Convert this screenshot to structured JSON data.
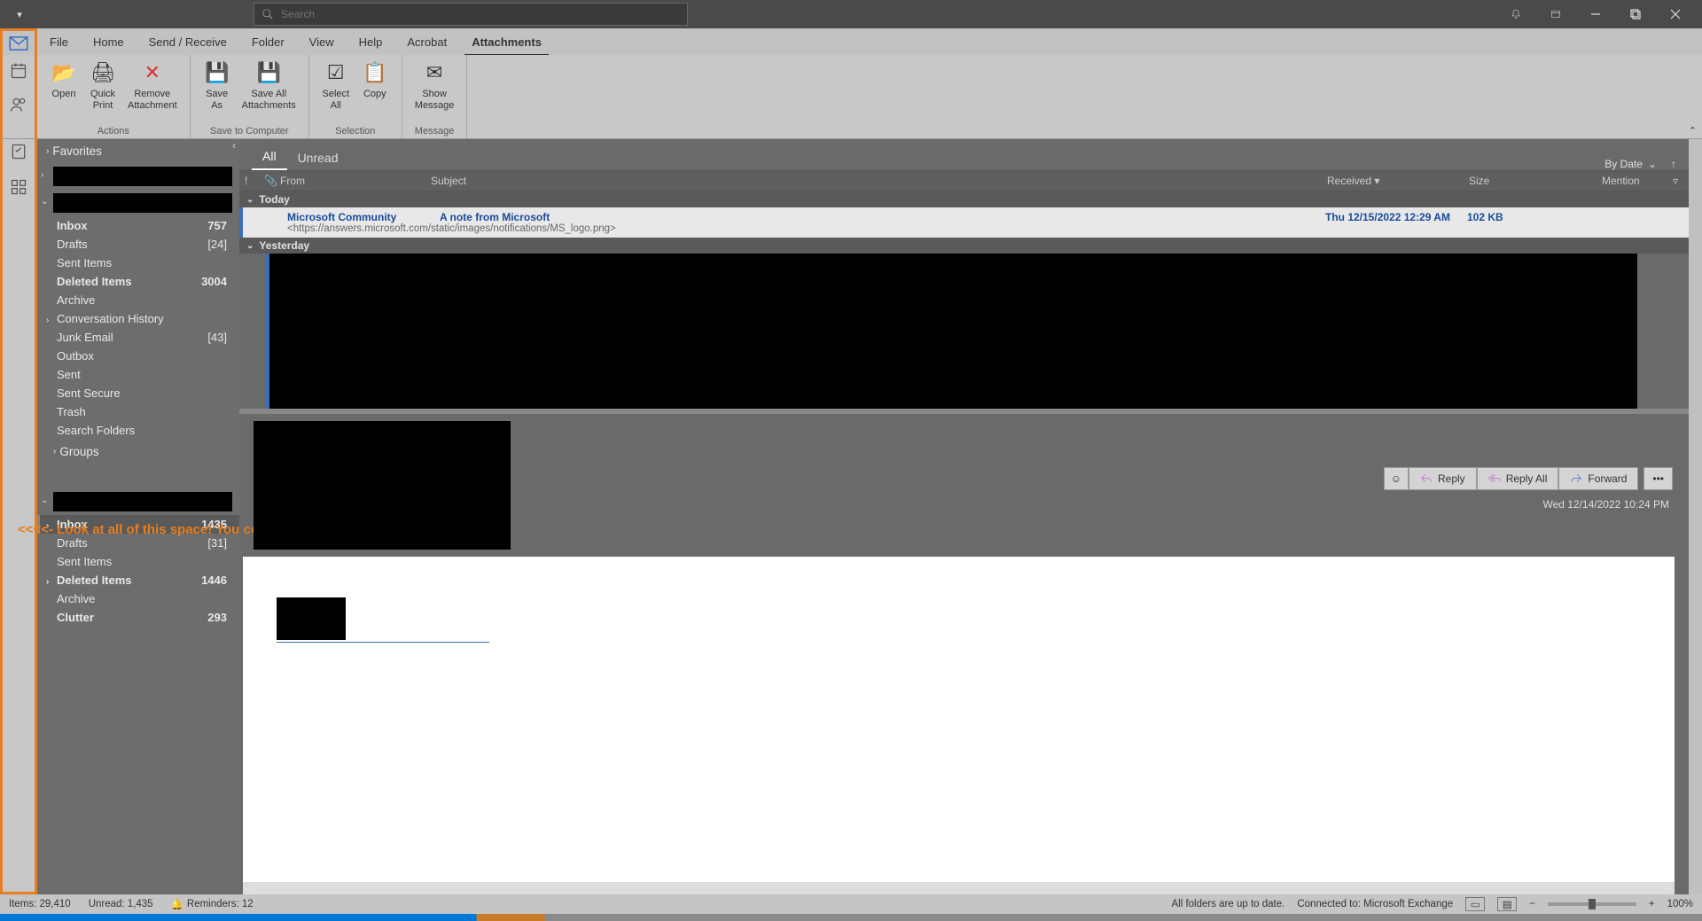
{
  "titlebar": {
    "searchPlaceholder": "Search"
  },
  "ribbonTabs": {
    "file": "File",
    "home": "Home",
    "sendReceive": "Send / Receive",
    "folder": "Folder",
    "view": "View",
    "help": "Help",
    "acrobat": "Acrobat",
    "attachments": "Attachments"
  },
  "ribbon": {
    "open": "Open",
    "quickPrint1": "Quick",
    "quickPrint2": "Print",
    "remove1": "Remove",
    "remove2": "Attachment",
    "saveAs1": "Save",
    "saveAs2": "As",
    "saveAll1": "Save All",
    "saveAll2": "Attachments",
    "selectAll1": "Select",
    "selectAll2": "All",
    "copy": "Copy",
    "showMsg1": "Show",
    "showMsg2": "Message",
    "grpActions": "Actions",
    "grpSave": "Save to Computer",
    "grpSelection": "Selection",
    "grpMessage": "Message"
  },
  "folderPane": {
    "favorites": "Favorites",
    "acct1": {
      "inbox": "Inbox",
      "inboxCount": "757",
      "drafts": "Drafts",
      "draftsCount": "[24]",
      "sentItems": "Sent Items",
      "deletedItems": "Deleted Items",
      "deletedCount": "3004",
      "archive": "Archive",
      "convHistory": "Conversation History",
      "junk": "Junk Email",
      "junkCount": "[43]",
      "outbox": "Outbox",
      "sent": "Sent",
      "sentSecure": "Sent Secure",
      "trash": "Trash",
      "searchFolders": "Search Folders"
    },
    "groups": "Groups",
    "annotation": "<<<<- Look at all of this space! You could park a locomotive here!",
    "acct2": {
      "inbox": "Inbox",
      "inboxCount": "1435",
      "drafts": "Drafts",
      "draftsCount": "[31]",
      "sentItems": "Sent Items",
      "deletedItems": "Deleted Items",
      "deletedCount": "1446",
      "archive": "Archive",
      "clutter": "Clutter",
      "clutterCount": "293"
    }
  },
  "listHeader": {
    "all": "All",
    "unread": "Unread",
    "sortBy": "By Date"
  },
  "columns": {
    "from": "From",
    "subject": "Subject",
    "received": "Received",
    "size": "Size",
    "mention": "Mention"
  },
  "dateGroups": {
    "today": "Today",
    "yesterday": "Yesterday"
  },
  "message1": {
    "from": "Microsoft Community",
    "subject": "A note from Microsoft",
    "preview": "<https://answers.microsoft.com/static/images/notifications/MS_logo.png>",
    "received": "Thu 12/15/2022 12:29 AM",
    "size": "102 KB"
  },
  "readingPane": {
    "reply": "Reply",
    "replyAll": "Reply All",
    "forward": "Forward",
    "timestamp": "Wed 12/14/2022 10:24 PM"
  },
  "statusBar": {
    "items": "Items: 29,410",
    "unread": "Unread: 1,435",
    "reminders": "Reminders: 12",
    "syncStatus": "All folders are up to date.",
    "connection": "Connected to: Microsoft Exchange",
    "zoom": "100%"
  }
}
